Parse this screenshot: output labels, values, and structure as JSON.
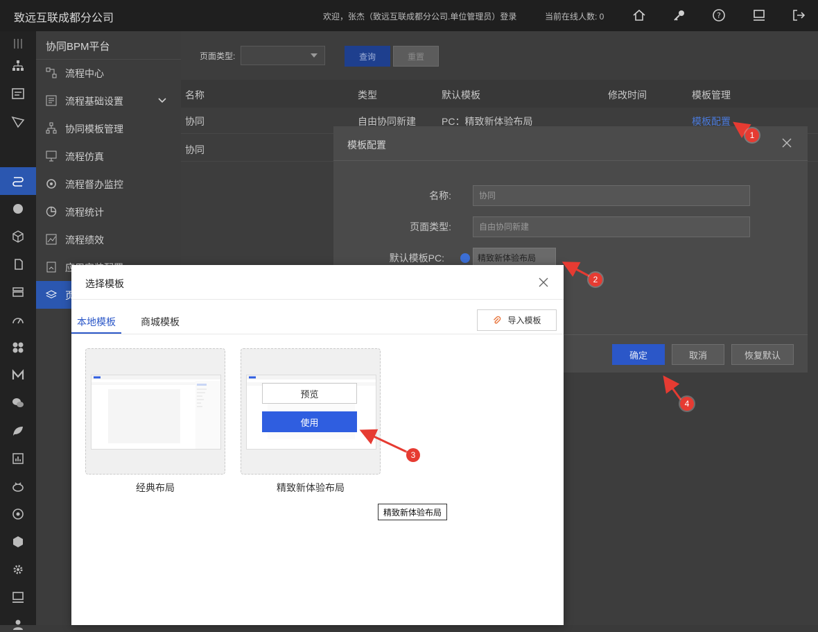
{
  "topbar": {
    "brand": "致远互联成都分公司",
    "welcome": "欢迎，张杰（致远互联成都分公司.单位管理员）登录",
    "online": "当前在线人数: 0"
  },
  "sidebar": {
    "title": "协同BPM平台",
    "items": [
      {
        "label": "流程中心"
      },
      {
        "label": "流程基础设置"
      },
      {
        "label": "协同模板管理"
      },
      {
        "label": "流程仿真"
      },
      {
        "label": "流程督办监控"
      },
      {
        "label": "流程统计"
      },
      {
        "label": "流程绩效"
      },
      {
        "label": "应用安装配置"
      },
      {
        "label": "页"
      }
    ]
  },
  "main": {
    "filter_label": "页面类型:",
    "query_btn": "查询",
    "reset_btn": "重置",
    "columns": [
      "名称",
      "类型",
      "默认模板",
      "修改时间",
      "模板管理"
    ],
    "rows": [
      {
        "name": "协同",
        "type": "自由协同新建",
        "default_tpl": "PC：精致新体验布局",
        "mtime": "",
        "manage": "模板配置"
      },
      {
        "name": "协同",
        "type": "",
        "default_tpl": "",
        "mtime": "",
        "manage": ""
      }
    ]
  },
  "config_dialog": {
    "title": "模板配置",
    "name_label": "名称:",
    "name_value": "协同",
    "page_type_label": "页面类型:",
    "page_type_value": "自由协同新建",
    "default_pc_label": "默认模板PC:",
    "default_pc_value": "精致新体验布局",
    "ok": "确定",
    "cancel": "取消",
    "restore": "恢复默认"
  },
  "select_dialog": {
    "title": "选择模板",
    "tab_local": "本地模板",
    "tab_mall": "商城模板",
    "import_btn": "导入模板",
    "cards": [
      {
        "label": "经典布局"
      },
      {
        "label": "精致新体验布局",
        "preview_btn": "预览",
        "use_btn": "使用"
      }
    ],
    "tooltip": "精致新体验布局"
  },
  "callouts": [
    "1",
    "2",
    "3",
    "4"
  ],
  "colors": {
    "accent": "#2b57c8",
    "callout": "#e63b32",
    "link": "#4a79d9"
  }
}
